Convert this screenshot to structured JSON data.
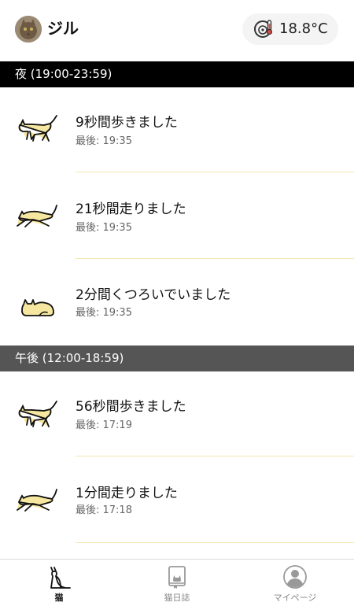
{
  "header": {
    "cat_name": "ジル",
    "temperature": "18.8°C"
  },
  "sections": [
    {
      "label": "夜 (19:00-23:59)",
      "items": [
        {
          "title": "9秒間歩きました",
          "last": "最後: 19:35",
          "icon": "walking-cat-icon"
        },
        {
          "title": "21秒間走りました",
          "last": "最後: 19:35",
          "icon": "running-cat-icon"
        },
        {
          "title": "2分間くつろいでいました",
          "last": "最後: 19:35",
          "icon": "resting-cat-icon"
        }
      ]
    },
    {
      "label": "午後 (12:00-18:59)",
      "items": [
        {
          "title": "56秒間歩きました",
          "last": "最後: 17:19",
          "icon": "walking-cat-icon"
        },
        {
          "title": "1分間走りました",
          "last": "最後: 17:18",
          "icon": "running-cat-icon"
        }
      ]
    }
  ],
  "tabs": [
    {
      "label": "猫",
      "icon": "cat-icon",
      "active": true
    },
    {
      "label": "猫日誌",
      "icon": "cat-diary-icon",
      "active": false
    },
    {
      "label": "マイページ",
      "icon": "profile-icon",
      "active": false
    }
  ],
  "colors": {
    "cat_fill": "#f6e7a0",
    "separator": "#f6e7b2",
    "night_header": "#000000",
    "afternoon_header": "#555555"
  }
}
